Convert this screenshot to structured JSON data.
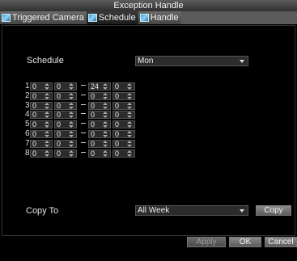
{
  "window": {
    "title": "Exception Handle"
  },
  "tabs": [
    {
      "label": "Triggered Camera",
      "icon": "picture-icon"
    },
    {
      "label": "Schedule",
      "icon": "picture-icon"
    },
    {
      "label": "Handle",
      "icon": "picture-icon"
    }
  ],
  "schedule": {
    "label": "Schedule",
    "day": "Mon"
  },
  "rows": [
    {
      "num": "1",
      "sh": "0",
      "sm": "0",
      "eh": "24",
      "em": "0"
    },
    {
      "num": "2",
      "sh": "0",
      "sm": "0",
      "eh": "0",
      "em": "0"
    },
    {
      "num": "3",
      "sh": "0",
      "sm": "0",
      "eh": "0",
      "em": "0"
    },
    {
      "num": "4",
      "sh": "0",
      "sm": "0",
      "eh": "0",
      "em": "0"
    },
    {
      "num": "5",
      "sh": "0",
      "sm": "0",
      "eh": "0",
      "em": "0"
    },
    {
      "num": "6",
      "sh": "0",
      "sm": "0",
      "eh": "0",
      "em": "0"
    },
    {
      "num": "7",
      "sh": "0",
      "sm": "0",
      "eh": "0",
      "em": "0"
    },
    {
      "num": "8",
      "sh": "0",
      "sm": "0",
      "eh": "0",
      "em": "0"
    }
  ],
  "copy_to": {
    "label": "Copy To",
    "value": "All Week",
    "button": "Copy"
  },
  "buttons": {
    "apply": "Apply",
    "ok": "OK",
    "cancel": "Cancel"
  }
}
